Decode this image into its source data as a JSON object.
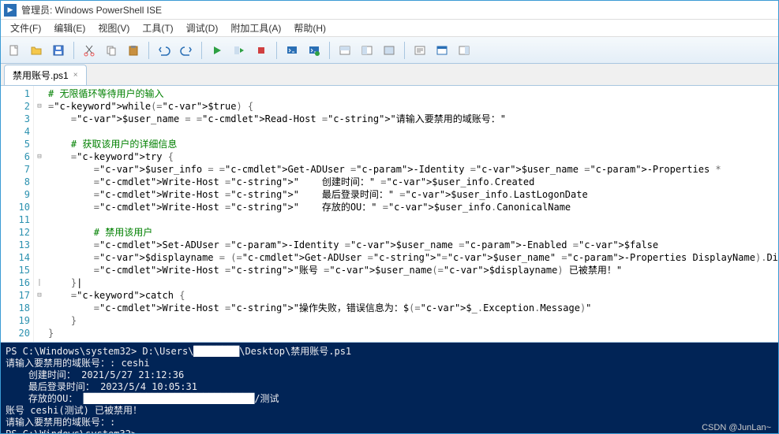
{
  "window": {
    "title": "管理员: Windows PowerShell ISE"
  },
  "menu": {
    "file": "文件(F)",
    "edit": "编辑(E)",
    "view": "视图(V)",
    "tools": "工具(T)",
    "debug": "调试(D)",
    "addons": "附加工具(A)",
    "help": "帮助(H)"
  },
  "toolbar_icons": {
    "new": "new-file-icon",
    "open": "open-folder-icon",
    "save": "save-icon",
    "cut": "cut-icon",
    "copy": "copy-icon",
    "paste": "paste-icon",
    "undo": "undo-icon",
    "redo": "redo-icon",
    "run": "run-icon",
    "run_selection": "run-selection-icon",
    "stop": "stop-icon",
    "new_remote": "remote-powershell-icon",
    "start_ps": "start-powershell-icon",
    "layout1": "layout-pane1-icon",
    "layout2": "layout-pane2-icon",
    "layout3": "layout-pane3-icon",
    "show_script": "show-script-pane-icon",
    "show_command": "show-command-icon",
    "show_toolbox": "show-toolbox-icon"
  },
  "tab": {
    "name": "禁用账号.ps1",
    "close": "×"
  },
  "code": {
    "lines": [
      {
        "n": 1,
        "raw": "# 无限循环等待用户的输入"
      },
      {
        "n": 2,
        "raw": "while($true) {"
      },
      {
        "n": 3,
        "raw": "    $user_name = Read-Host \"请输入要禁用的域账号：\""
      },
      {
        "n": 4,
        "raw": ""
      },
      {
        "n": 5,
        "raw": "    # 获取该用户的详细信息"
      },
      {
        "n": 6,
        "raw": "    try {"
      },
      {
        "n": 7,
        "raw": "        $user_info = Get-ADUser -Identity $user_name -Properties *"
      },
      {
        "n": 8,
        "raw": "        Write-Host \"    创建时间：\" $user_info.Created"
      },
      {
        "n": 9,
        "raw": "        Write-Host \"    最后登录时间：\" $user_info.LastLogonDate"
      },
      {
        "n": 10,
        "raw": "        Write-Host \"    存放的OU：\" $user_info.CanonicalName"
      },
      {
        "n": 11,
        "raw": ""
      },
      {
        "n": 12,
        "raw": "        # 禁用该用户"
      },
      {
        "n": 13,
        "raw": "        Set-ADUser -Identity $user_name -Enabled $false"
      },
      {
        "n": 14,
        "raw": "        $displayname = (Get-ADUser \"$user_name\" -Properties DisplayName).DisplayName #只显示账号的DisplayName值，只需要返回相应的值，不显示任何多余的信息"
      },
      {
        "n": 15,
        "raw": "        Write-Host \"账号 $user_name($displayname) 已被禁用！\""
      },
      {
        "n": 16,
        "raw": "    }|"
      },
      {
        "n": 17,
        "raw": "    catch {"
      },
      {
        "n": 18,
        "raw": "        Write-Host \"操作失败，错误信息为：$($_.Exception.Message)\""
      },
      {
        "n": 19,
        "raw": "    }"
      },
      {
        "n": 20,
        "raw": "}"
      }
    ]
  },
  "console": {
    "l1_prefix": "PS C:\\Windows\\system32> D:\\Users\\",
    "l1_suffix": "\\Desktop\\禁用账号.ps1",
    "l2": "请输入要禁用的域账号：: ceshi",
    "l3": "    创建时间： 2021/5/27 21:12:36",
    "l4": "    最后登录时间： 2023/5/4 10:05:31",
    "l5_prefix": "    存放的OU： ",
    "l5_suffix": "/测试",
    "l6": "账号 ceshi(测试) 已被禁用！",
    "l7": "请输入要禁用的域账号：: ",
    "l8": "PS C:\\Windows\\system32> "
  },
  "watermark": "CSDN @JunLan~"
}
